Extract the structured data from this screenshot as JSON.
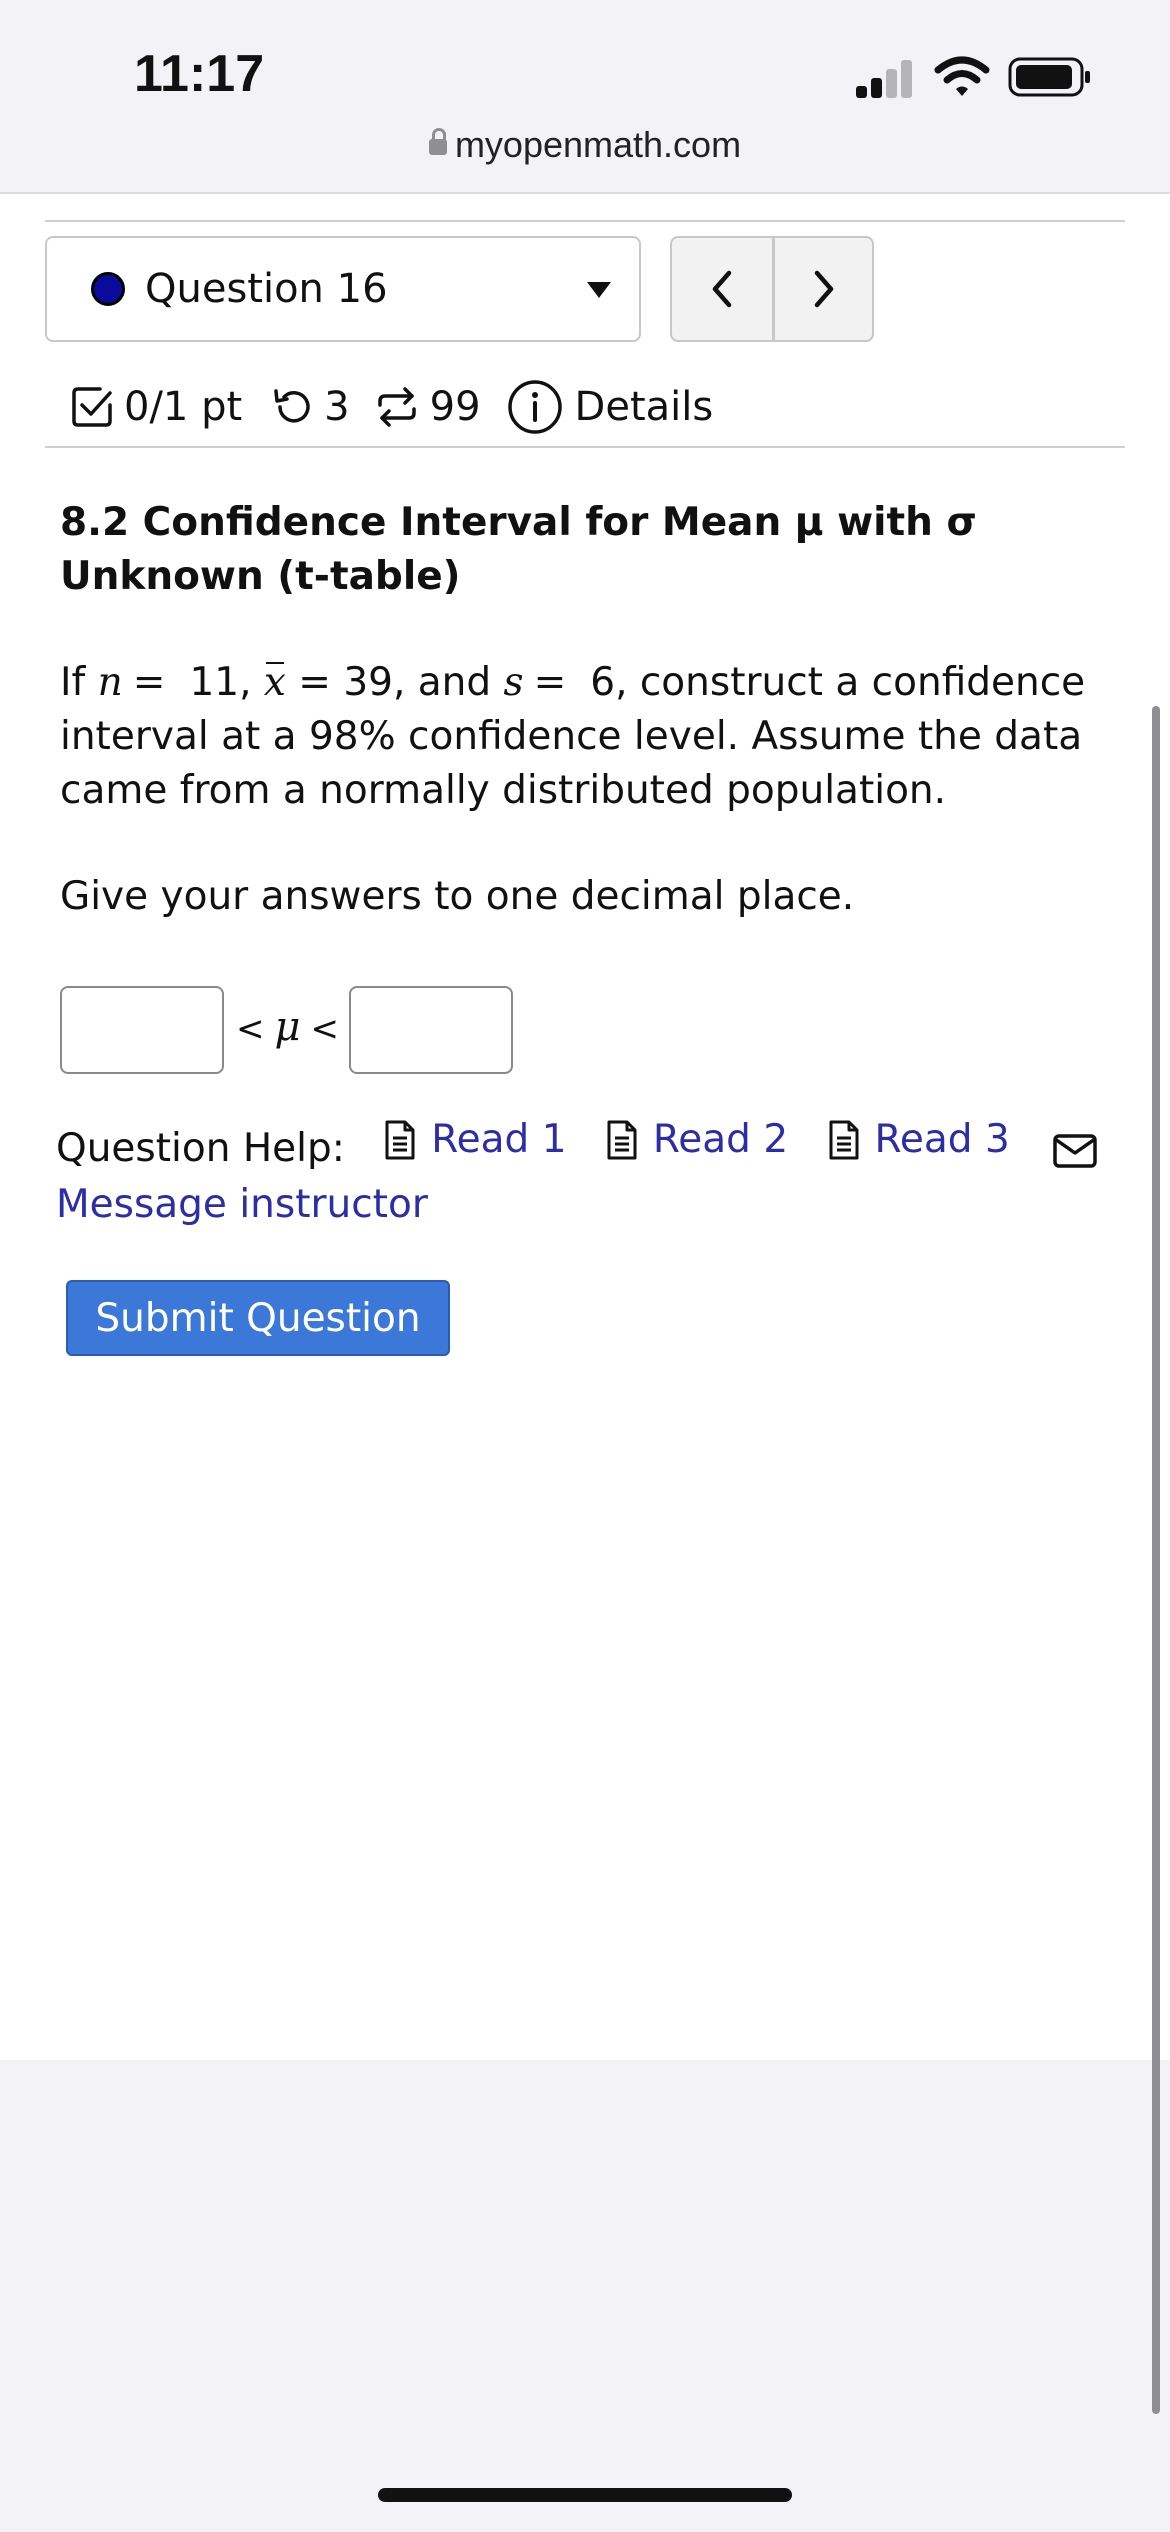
{
  "status_bar": {
    "time": "11:17"
  },
  "browser": {
    "url": "myopenmath.com"
  },
  "question_selector": {
    "label": "Question 16",
    "status_color": "#0a0a9c"
  },
  "meta": {
    "score": "0/1 pt",
    "retries": "3",
    "attempts": "99",
    "details": "Details"
  },
  "question": {
    "title": "8.2 Confidence Interval for Mean μ with σ Unknown (t-table)",
    "body": {
      "if": "If ",
      "n_var": "n",
      "eq": "=",
      "n_val": "11, ",
      "xbar_var": "x",
      "xbar_eq": " = 39, and ",
      "s_var": "s",
      "s_eq": "=",
      "s_val": "6, construct a confidence interval at a 98% confidence level. Assume the data came from a normally distributed population."
    },
    "instruction": "Give your answers to one decimal place.",
    "inequality": {
      "lt1": "<",
      "mu": "μ",
      "lt2": "<"
    },
    "lower_value": "",
    "upper_value": ""
  },
  "help": {
    "label": "Question Help:",
    "links": [
      "Read 1",
      "Read 2",
      "Read 3"
    ],
    "message": "Message instructor"
  },
  "submit_label": "Submit Question",
  "colors": {
    "link": "#2b2ea6",
    "submit": "#3c78d8"
  }
}
